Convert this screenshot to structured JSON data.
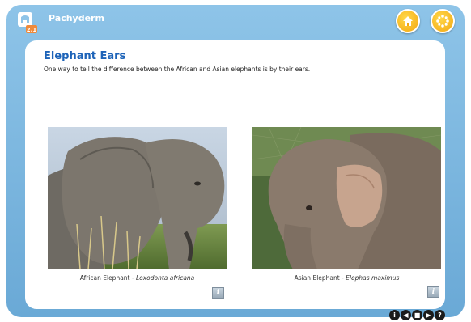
{
  "header": {
    "app_title": "Pachyderm",
    "logo_badge": "2.1",
    "home_icon": "home-icon",
    "menu_icon": "menu-dots-icon"
  },
  "lesson": {
    "title": "Elephant Ears",
    "intro": "One way to tell the difference between the African and Asian elephants is by their ears."
  },
  "images": [
    {
      "caption_common": "African Elephant - ",
      "caption_scientific": "Loxodonta africana",
      "info_label": "i"
    },
    {
      "caption_common": "Asian Elephant - ",
      "caption_scientific": "Elephas maximus",
      "info_label": "i"
    }
  ],
  "footer_controls": [
    {
      "icon": "info-circle-icon",
      "glyph": "i"
    },
    {
      "icon": "back-circle-icon",
      "glyph": "◀"
    },
    {
      "icon": "stop-circle-icon",
      "glyph": "■"
    },
    {
      "icon": "forward-circle-icon",
      "glyph": "▶"
    },
    {
      "icon": "help-circle-icon",
      "glyph": "?"
    }
  ],
  "colors": {
    "frame": "#7ab6e0",
    "title": "#1d63b8",
    "button": "#f3a712"
  }
}
